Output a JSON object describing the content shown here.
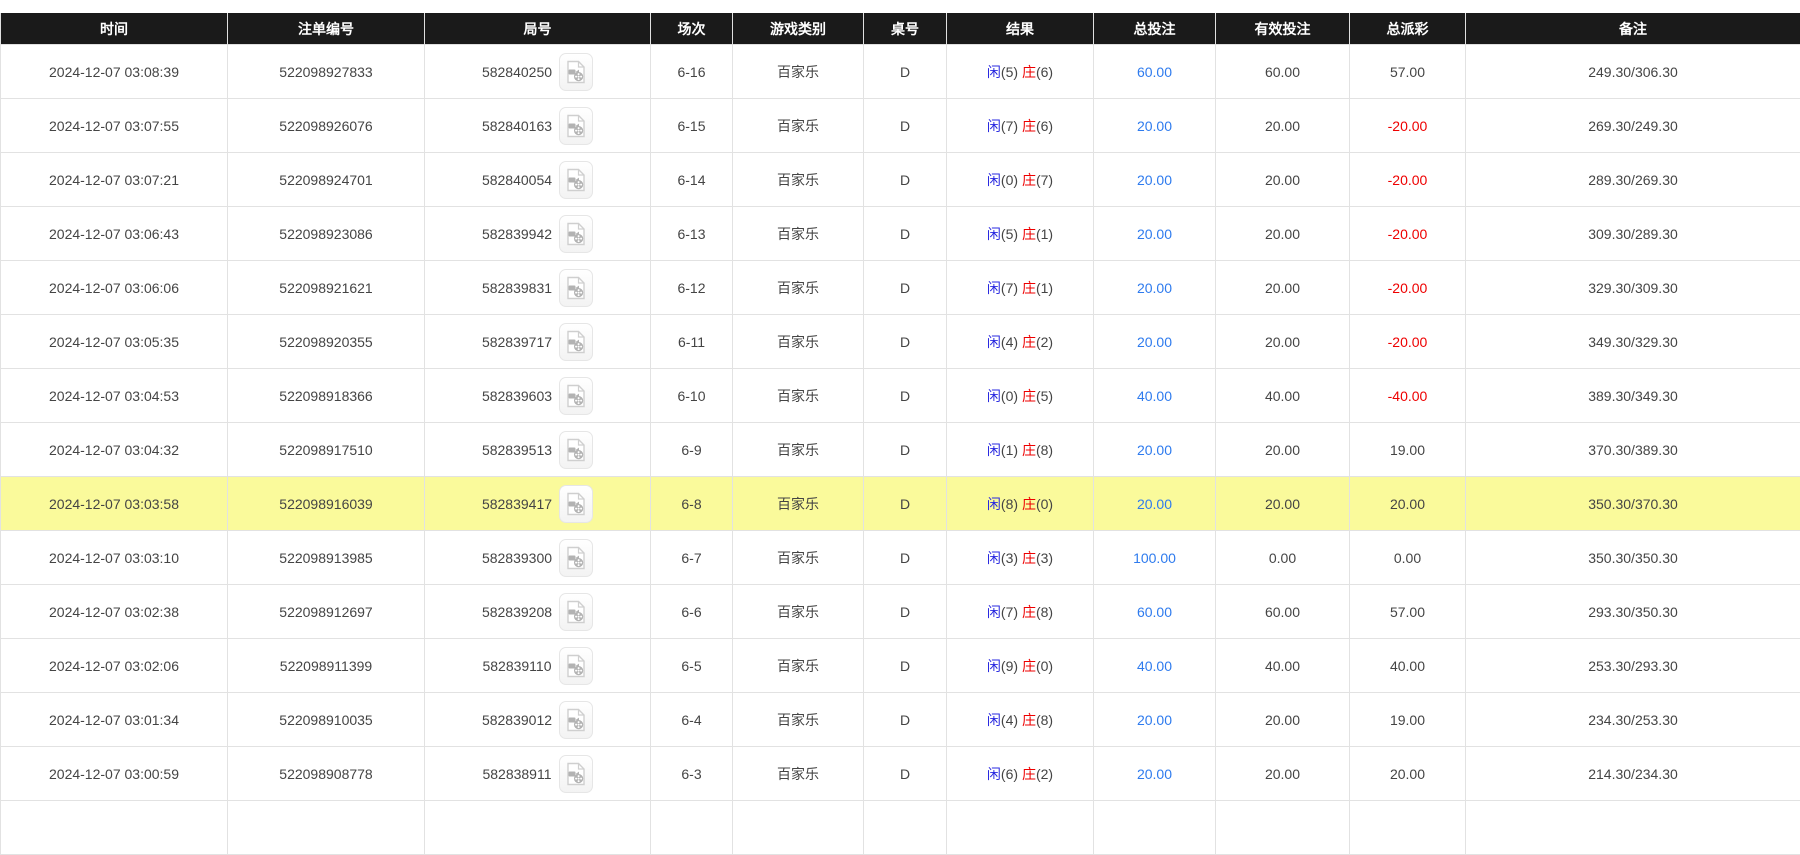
{
  "colors": {
    "header_bg": "#1a1a1a",
    "header_text": "#ffffff",
    "row_border": "#e2e2e2",
    "body_text": "#444444",
    "highlight_row_bg": "#fafa9b",
    "total_bet_link": "#2e7bee",
    "player_blue": "#2828e0",
    "banker_red": "#ee0000",
    "negative_red": "#ee0000"
  },
  "icons": {
    "video_replay": "video-replay-icon"
  },
  "table": {
    "columns": [
      {
        "key": "time",
        "label": "时间"
      },
      {
        "key": "bet_id",
        "label": "注单编号"
      },
      {
        "key": "round",
        "label": "局号"
      },
      {
        "key": "session",
        "label": "场次"
      },
      {
        "key": "game_type",
        "label": "游戏类别"
      },
      {
        "key": "table_no",
        "label": "桌号"
      },
      {
        "key": "result",
        "label": "结果"
      },
      {
        "key": "total_bet",
        "label": "总投注"
      },
      {
        "key": "valid_bet",
        "label": "有效投注"
      },
      {
        "key": "payout",
        "label": "总派彩"
      },
      {
        "key": "remark",
        "label": "备注"
      }
    ],
    "rows": [
      {
        "time": "2024-12-07 03:08:39",
        "bet_id": "522098927833",
        "round": "582840250",
        "session": "6-16",
        "game_type": "百家乐",
        "table_no": "D",
        "player_name": "闲",
        "player_value": "(5)",
        "banker_name": "庄",
        "banker_value": "(6)",
        "total_bet": "60.00",
        "valid_bet": "60.00",
        "payout": "57.00",
        "payout_negative": false,
        "remark": "249.30/306.30",
        "highlighted": false
      },
      {
        "time": "2024-12-07 03:07:55",
        "bet_id": "522098926076",
        "round": "582840163",
        "session": "6-15",
        "game_type": "百家乐",
        "table_no": "D",
        "player_name": "闲",
        "player_value": "(7)",
        "banker_name": "庄",
        "banker_value": "(6)",
        "total_bet": "20.00",
        "valid_bet": "20.00",
        "payout": "-20.00",
        "payout_negative": true,
        "remark": "269.30/249.30",
        "highlighted": false
      },
      {
        "time": "2024-12-07 03:07:21",
        "bet_id": "522098924701",
        "round": "582840054",
        "session": "6-14",
        "game_type": "百家乐",
        "table_no": "D",
        "player_name": "闲",
        "player_value": "(0)",
        "banker_name": "庄",
        "banker_value": "(7)",
        "total_bet": "20.00",
        "valid_bet": "20.00",
        "payout": "-20.00",
        "payout_negative": true,
        "remark": "289.30/269.30",
        "highlighted": false
      },
      {
        "time": "2024-12-07 03:06:43",
        "bet_id": "522098923086",
        "round": "582839942",
        "session": "6-13",
        "game_type": "百家乐",
        "table_no": "D",
        "player_name": "闲",
        "player_value": "(5)",
        "banker_name": "庄",
        "banker_value": "(1)",
        "total_bet": "20.00",
        "valid_bet": "20.00",
        "payout": "-20.00",
        "payout_negative": true,
        "remark": "309.30/289.30",
        "highlighted": false
      },
      {
        "time": "2024-12-07 03:06:06",
        "bet_id": "522098921621",
        "round": "582839831",
        "session": "6-12",
        "game_type": "百家乐",
        "table_no": "D",
        "player_name": "闲",
        "player_value": "(7)",
        "banker_name": "庄",
        "banker_value": "(1)",
        "total_bet": "20.00",
        "valid_bet": "20.00",
        "payout": "-20.00",
        "payout_negative": true,
        "remark": "329.30/309.30",
        "highlighted": false
      },
      {
        "time": "2024-12-07 03:05:35",
        "bet_id": "522098920355",
        "round": "582839717",
        "session": "6-11",
        "game_type": "百家乐",
        "table_no": "D",
        "player_name": "闲",
        "player_value": "(4)",
        "banker_name": "庄",
        "banker_value": "(2)",
        "total_bet": "20.00",
        "valid_bet": "20.00",
        "payout": "-20.00",
        "payout_negative": true,
        "remark": "349.30/329.30",
        "highlighted": false
      },
      {
        "time": "2024-12-07 03:04:53",
        "bet_id": "522098918366",
        "round": "582839603",
        "session": "6-10",
        "game_type": "百家乐",
        "table_no": "D",
        "player_name": "闲",
        "player_value": "(0)",
        "banker_name": "庄",
        "banker_value": "(5)",
        "total_bet": "40.00",
        "valid_bet": "40.00",
        "payout": "-40.00",
        "payout_negative": true,
        "remark": "389.30/349.30",
        "highlighted": false
      },
      {
        "time": "2024-12-07 03:04:32",
        "bet_id": "522098917510",
        "round": "582839513",
        "session": "6-9",
        "game_type": "百家乐",
        "table_no": "D",
        "player_name": "闲",
        "player_value": "(1)",
        "banker_name": "庄",
        "banker_value": "(8)",
        "total_bet": "20.00",
        "valid_bet": "20.00",
        "payout": "19.00",
        "payout_negative": false,
        "remark": "370.30/389.30",
        "highlighted": false
      },
      {
        "time": "2024-12-07 03:03:58",
        "bet_id": "522098916039",
        "round": "582839417",
        "session": "6-8",
        "game_type": "百家乐",
        "table_no": "D",
        "player_name": "闲",
        "player_value": "(8)",
        "banker_name": "庄",
        "banker_value": "(0)",
        "total_bet": "20.00",
        "valid_bet": "20.00",
        "payout": "20.00",
        "payout_negative": false,
        "remark": "350.30/370.30",
        "highlighted": true
      },
      {
        "time": "2024-12-07 03:03:10",
        "bet_id": "522098913985",
        "round": "582839300",
        "session": "6-7",
        "game_type": "百家乐",
        "table_no": "D",
        "player_name": "闲",
        "player_value": "(3)",
        "banker_name": "庄",
        "banker_value": "(3)",
        "total_bet": "100.00",
        "valid_bet": "0.00",
        "payout": "0.00",
        "payout_negative": false,
        "remark": "350.30/350.30",
        "highlighted": false
      },
      {
        "time": "2024-12-07 03:02:38",
        "bet_id": "522098912697",
        "round": "582839208",
        "session": "6-6",
        "game_type": "百家乐",
        "table_no": "D",
        "player_name": "闲",
        "player_value": "(7)",
        "banker_name": "庄",
        "banker_value": "(8)",
        "total_bet": "60.00",
        "valid_bet": "60.00",
        "payout": "57.00",
        "payout_negative": false,
        "remark": "293.30/350.30",
        "highlighted": false
      },
      {
        "time": "2024-12-07 03:02:06",
        "bet_id": "522098911399",
        "round": "582839110",
        "session": "6-5",
        "game_type": "百家乐",
        "table_no": "D",
        "player_name": "闲",
        "player_value": "(9)",
        "banker_name": "庄",
        "banker_value": "(0)",
        "total_bet": "40.00",
        "valid_bet": "40.00",
        "payout": "40.00",
        "payout_negative": false,
        "remark": "253.30/293.30",
        "highlighted": false
      },
      {
        "time": "2024-12-07 03:01:34",
        "bet_id": "522098910035",
        "round": "582839012",
        "session": "6-4",
        "game_type": "百家乐",
        "table_no": "D",
        "player_name": "闲",
        "player_value": "(4)",
        "banker_name": "庄",
        "banker_value": "(8)",
        "total_bet": "20.00",
        "valid_bet": "20.00",
        "payout": "19.00",
        "payout_negative": false,
        "remark": "234.30/253.30",
        "highlighted": false
      },
      {
        "time": "2024-12-07 03:00:59",
        "bet_id": "522098908778",
        "round": "582838911",
        "session": "6-3",
        "game_type": "百家乐",
        "table_no": "D",
        "player_name": "闲",
        "player_value": "(6)",
        "banker_name": "庄",
        "banker_value": "(2)",
        "total_bet": "20.00",
        "valid_bet": "20.00",
        "payout": "20.00",
        "payout_negative": false,
        "remark": "214.30/234.30",
        "highlighted": false
      }
    ]
  }
}
